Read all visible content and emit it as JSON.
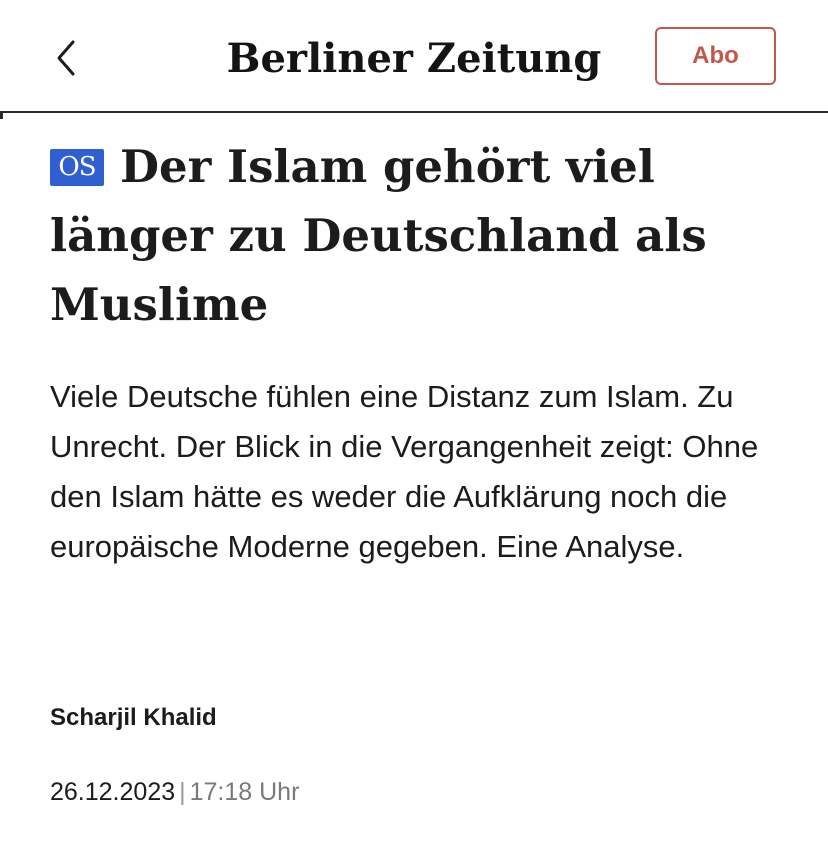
{
  "header": {
    "back_icon": "chevron-left-icon",
    "logo_text": "Berliner Zeitung",
    "abo_label": "Abo",
    "accent_color": "#c2584a"
  },
  "article": {
    "badge": "OS",
    "badge_color": "#2f5fd0",
    "headline": "Der Islam gehört viel länger zu Deutschland als Muslime",
    "teaser": "Viele Deutsche fühlen eine Distanz zum Islam. Zu Unrecht. Der Blick in die Vergangenheit zeigt: Ohne den Islam hätte es weder die Aufklärung noch die europäische Moderne gegeben. Eine Analyse.",
    "author": "Scharjil Khalid",
    "date": "26.12.2023",
    "separator": "|",
    "time": "17:18 Uhr"
  }
}
